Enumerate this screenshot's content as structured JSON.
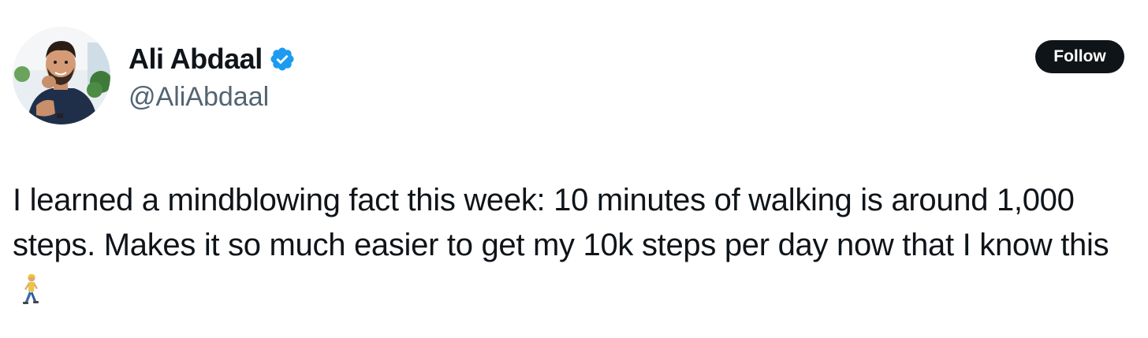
{
  "tweet": {
    "author": {
      "display_name": "Ali Abdaal",
      "handle": "@AliAbdaal",
      "verified": true,
      "avatar_icon": "profile-photo"
    },
    "follow_label": "Follow",
    "text": "I learned a mindblowing fact this week: 10 minutes of walking is around 1,000 steps. Makes it so much easier to get my 10k steps per day now that I know this",
    "emoji_icon": "person-walking-icon"
  },
  "colors": {
    "text_primary": "#0f1419",
    "text_secondary": "#536471",
    "verified_blue": "#1d9bf0",
    "button_bg": "#0f1419",
    "button_text": "#ffffff"
  }
}
